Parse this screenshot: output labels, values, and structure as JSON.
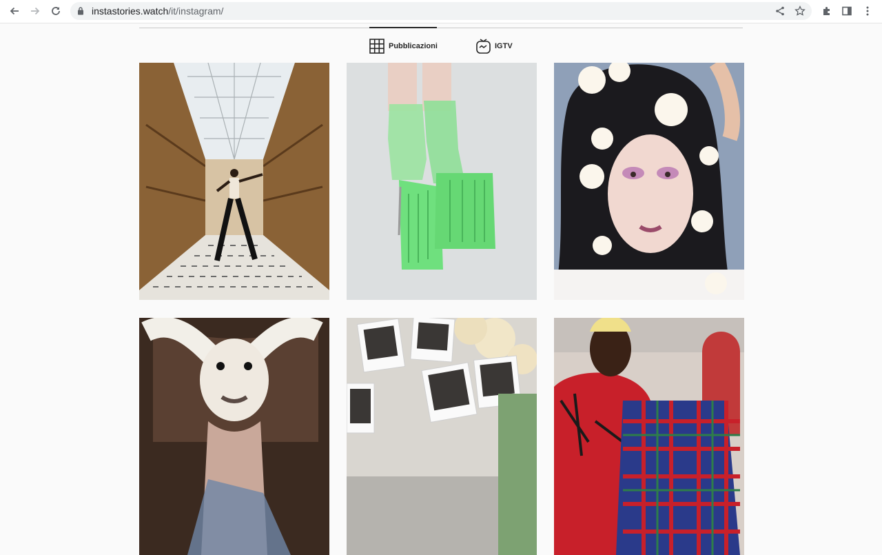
{
  "browser": {
    "url_host": "instastories.watch",
    "url_path": "/it/instagram/"
  },
  "tabs": [
    {
      "label": "Pubblicazioni",
      "icon": "grid-icon",
      "active": true
    },
    {
      "label": "IGTV",
      "icon": "igtv-icon",
      "active": false
    }
  ],
  "posts": [
    {
      "subject": "man-in-arcade-gallery"
    },
    {
      "subject": "green-platform-boots"
    },
    {
      "subject": "woman-with-white-flowers"
    },
    {
      "subject": "chinese-crested-dog"
    },
    {
      "subject": "polaroids-and-paper-lanterns"
    },
    {
      "subject": "man-holding-plaid-jacket"
    }
  ]
}
